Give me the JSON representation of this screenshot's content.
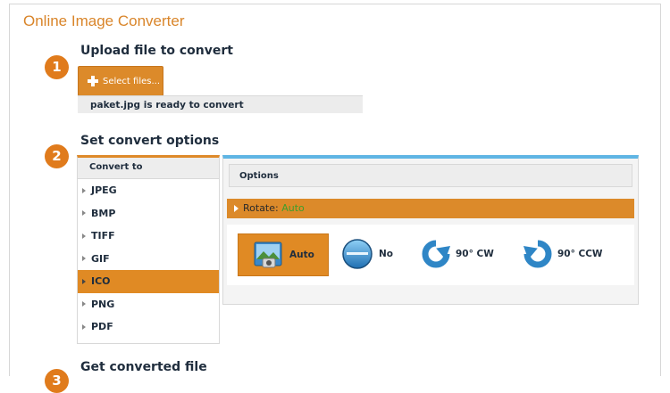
{
  "app": {
    "title": "Online Image Converter"
  },
  "steps": [
    {
      "number": "1",
      "title": "Upload file to convert"
    },
    {
      "number": "2",
      "title": "Set convert options"
    },
    {
      "number": "3",
      "title": "Get converted file"
    }
  ],
  "upload": {
    "button_label": "Select files...",
    "status": "paket.jpg is ready to convert"
  },
  "convert_to": {
    "header": "Convert to",
    "formats": [
      "JPEG",
      "BMP",
      "TIFF",
      "GIF",
      "ICO",
      "PNG",
      "PDF"
    ],
    "selected": "ICO"
  },
  "options": {
    "header": "Options",
    "rotate_label": "Rotate:",
    "rotate_value": "Auto",
    "rotate_choices": [
      {
        "label": "Auto",
        "icon": "photo-icon"
      },
      {
        "label": "No",
        "icon": "circle-icon"
      },
      {
        "label": "90° CW",
        "icon": "rotate-cw-icon"
      },
      {
        "label": "90° CCW",
        "icon": "rotate-ccw-icon"
      }
    ]
  },
  "colors": {
    "accent_orange": "#dc8a2a",
    "accent_blue": "#5fb5e4",
    "title_orange": "#d9852a",
    "value_green": "#3d9e2c"
  }
}
